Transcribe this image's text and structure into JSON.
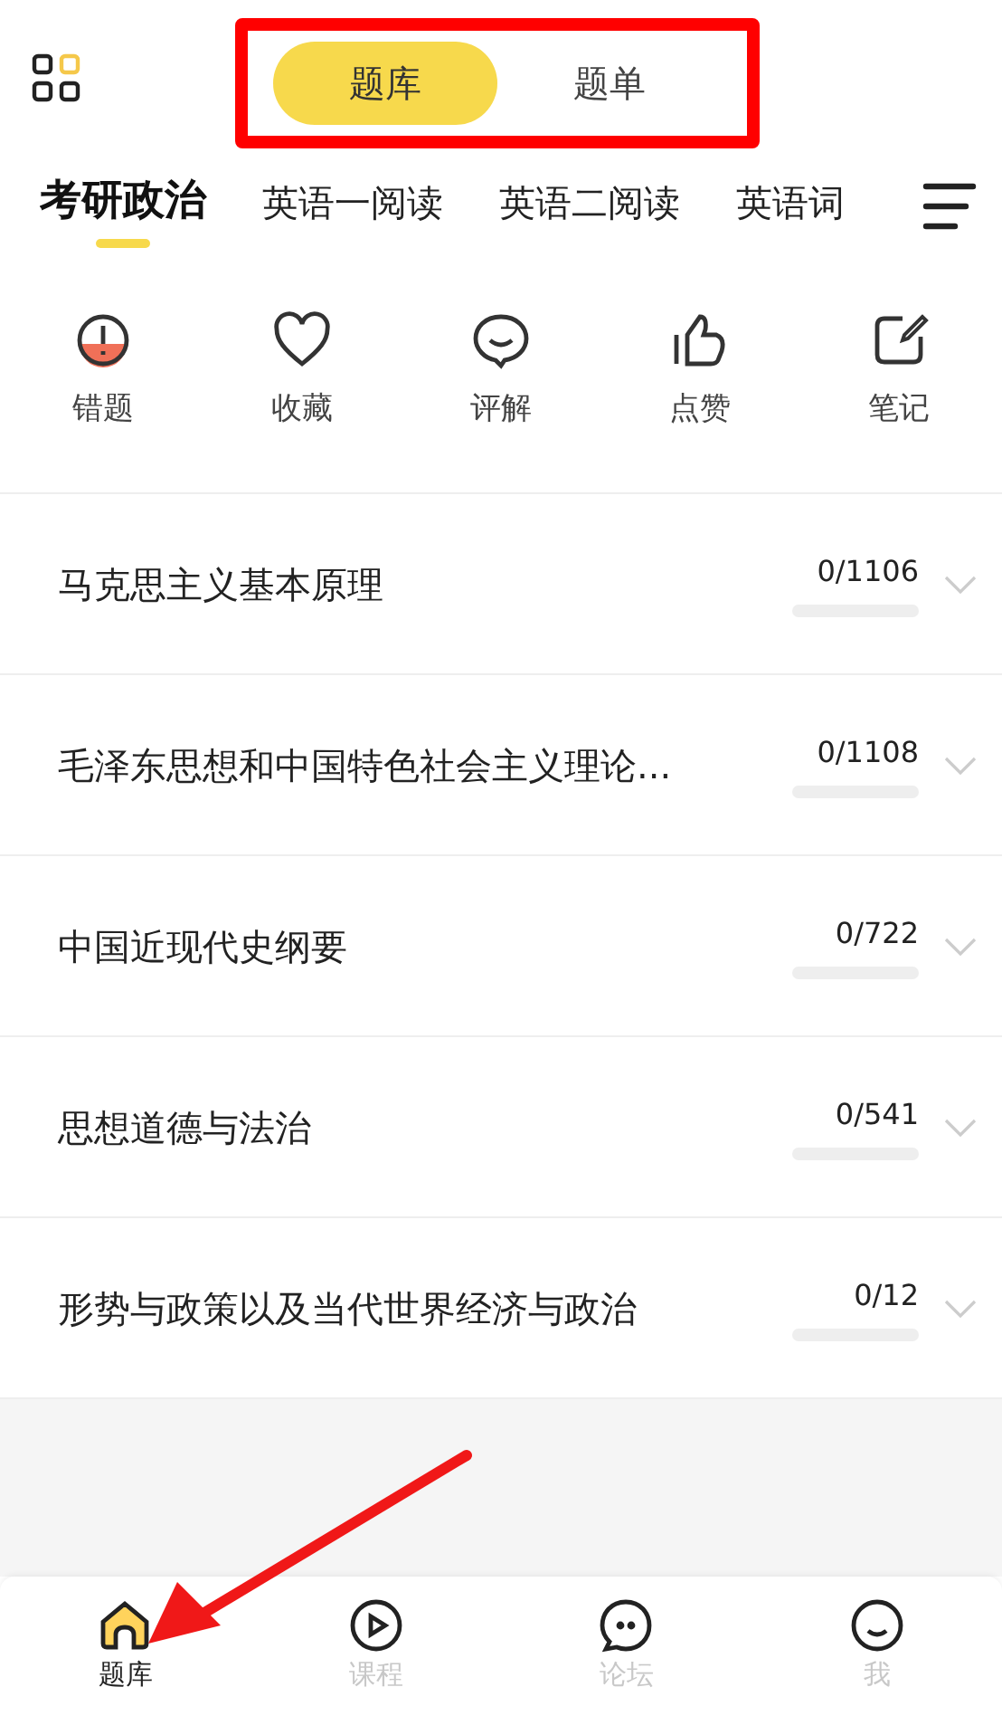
{
  "mode_tabs": [
    {
      "label": "题库",
      "selected": true
    },
    {
      "label": "题单",
      "selected": false
    }
  ],
  "subject_tabs": [
    {
      "label": "考研政治",
      "selected": true
    },
    {
      "label": "英语一阅读",
      "selected": false
    },
    {
      "label": "英语二阅读",
      "selected": false
    },
    {
      "label": "英语词",
      "selected": false
    }
  ],
  "shortcuts": [
    {
      "kind": "wrong",
      "label": "错题"
    },
    {
      "kind": "favorite",
      "label": "收藏"
    },
    {
      "kind": "comment",
      "label": "评解"
    },
    {
      "kind": "like",
      "label": "点赞"
    },
    {
      "kind": "note",
      "label": "笔记"
    }
  ],
  "chapters": [
    {
      "title": "马克思主义基本原理",
      "count": "0/1106",
      "level": 0
    },
    {
      "title": "毛泽东思想和中国特色社会主义理论...",
      "count": "0/1108",
      "level": 0
    },
    {
      "title": "中国近现代史纲要",
      "count": "0/722",
      "level": 0
    },
    {
      "title": "思想道德与法治",
      "count": "0/541",
      "level": 0
    },
    {
      "title": "形势与政策以及当代世界经济与政治",
      "count": "0/12",
      "level": 0
    }
  ],
  "bottom_nav": [
    {
      "kind": "home",
      "label": "题库",
      "selected": true
    },
    {
      "kind": "play",
      "label": "课程",
      "selected": false
    },
    {
      "kind": "chat",
      "label": "论坛",
      "selected": false
    },
    {
      "kind": "smile",
      "label": "我",
      "selected": false
    }
  ]
}
